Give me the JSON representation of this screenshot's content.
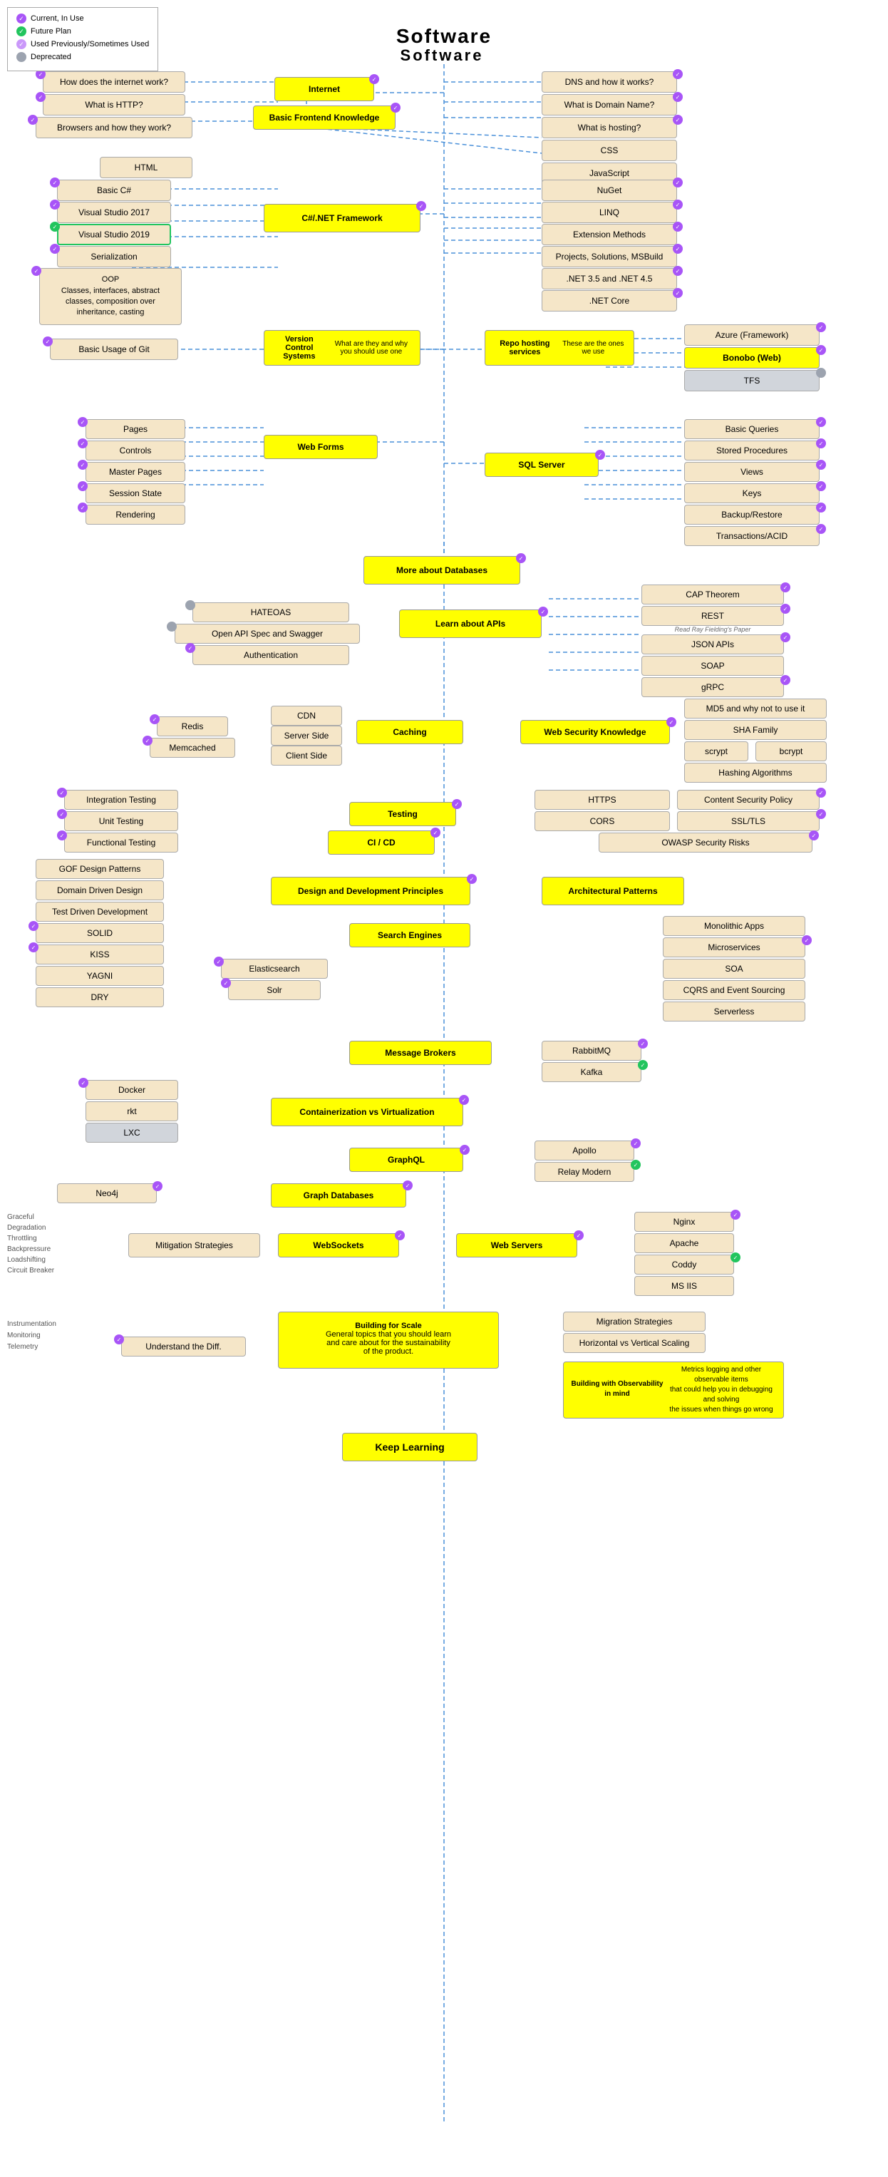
{
  "legend": {
    "items": [
      {
        "label": "Current, In Use",
        "dotClass": "dot-current",
        "icon": "✓"
      },
      {
        "label": "Future Plan",
        "dotClass": "dot-future",
        "icon": "✓"
      },
      {
        "label": "Used Previously/Sometimes Used",
        "dotClass": "dot-used",
        "icon": "✓"
      },
      {
        "label": "Deprecated",
        "dotClass": "dot-deprecated",
        "icon": ""
      }
    ]
  },
  "title": "Software",
  "nodes": {
    "internet": "Internet",
    "basicFrontend": "Basic Frontend Knowledge",
    "howInternet": "How does the internet work?",
    "whatHTTP": "What is HTTP?",
    "browsers": "Browsers and how they work?",
    "dns": "DNS and how it works?",
    "domainName": "What is Domain Name?",
    "hosting": "What is hosting?",
    "css": "CSS",
    "javascript": "JavaScript",
    "html": "HTML",
    "dotnet": "C#/.NET Framework",
    "basicCsharp": "Basic C#",
    "vs2017": "Visual Studio 2017",
    "vs2019": "Visual Studio 2019",
    "serialization": "Serialization",
    "oop": "OOP\nClasses, interfaces, abstract\nclasses, composition over\ninheritance, casting",
    "nuget": "NuGet",
    "linq": "LINQ",
    "extensionMethods": "Extension Methods",
    "projects": "Projects, Solutions, MSBuild",
    "net35": ".NET 3.5 and .NET 4.5",
    "netCore": ".NET Core",
    "vcs": "Version Control Systems\nWhat are they and why you should use one",
    "repoHosting": "Repo hosting services\nThese are the ones we use",
    "basicGit": "Basic Usage of Git",
    "azure": "Azure (Framework)",
    "bonobo": "Bonobo (Web)",
    "tfs": "TFS",
    "webForms": "Web Forms",
    "sqlServer": "SQL Server",
    "pages": "Pages",
    "controls": "Controls",
    "masterPages": "Master Pages",
    "sessionState": "Session State",
    "rendering": "Rendering",
    "basicQueries": "Basic Queries",
    "storedProcs": "Stored Procedures",
    "views": "Views",
    "keys": "Keys",
    "backupRestore": "Backup/Restore",
    "transactions": "Transactions/ACID",
    "moreDatabases": "More about Databases",
    "capTheorem": "CAP Theorem",
    "rest": "REST",
    "readRay": "Read Ray Fielding's Paper",
    "jsonApis": "JSON APIs",
    "soap": "SOAP",
    "grpc": "gRPC",
    "learnAPIs": "Learn about APIs",
    "hateoas": "HATEOAS",
    "openAPI": "Open API Spec and Swagger",
    "authentication": "Authentication",
    "caching": "Caching",
    "cdn": "CDN",
    "serverSide": "Server Side",
    "clientSide": "Client Side",
    "redis": "Redis",
    "memcached": "Memcached",
    "webSecurity": "Web Security Knowledge",
    "md5": "MD5 and why not to use it",
    "shaFamily": "SHA Family",
    "scrypt": "scrypt",
    "bcrypt": "bcrypt",
    "hashingAlgorithms": "Hashing Algorithms",
    "testing": "Testing",
    "integrationTesting": "Integration Testing",
    "unitTesting": "Unit Testing",
    "functionalTesting": "Functional Testing",
    "cicd": "CI / CD",
    "https": "HTTPS",
    "contentSecurity": "Content Security Policy",
    "cors": "CORS",
    "ssltls": "SSL/TLS",
    "owasp": "OWASP Security Risks",
    "designPrinciples": "Design and Development Principles",
    "gof": "GOF Design Patterns",
    "ddd": "Domain Driven Design",
    "tdd": "Test Driven Development",
    "solid": "SOLID",
    "kiss": "KISS",
    "yagni": "YAGNI",
    "dry": "DRY",
    "architecturalPatterns": "Architectural Patterns",
    "monolithicApps": "Monolithic Apps",
    "microservices": "Microservices",
    "soa": "SOA",
    "cqrs": "CQRS and Event Sourcing",
    "serverless": "Serverless",
    "searchEngines": "Search Engines",
    "elasticsearch": "Elasticsearch",
    "solr": "Solr",
    "messageBrokers": "Message Brokers",
    "rabbitMQ": "RabbitMQ",
    "kafka": "Kafka",
    "containerization": "Containerization vs Virtualization",
    "docker": "Docker",
    "rkt": "rkt",
    "lxc": "LXC",
    "graphql": "GraphQL",
    "apollo": "Apollo",
    "relayModern": "Relay Modern",
    "graphDatabases": "Graph Databases",
    "neo4j": "Neo4j",
    "webSockets": "WebSockets",
    "webServers": "Web Servers",
    "nginx": "Nginx",
    "apache": "Apache",
    "coddy": "Coddy",
    "msiis": "MS IIS",
    "mitigationStrategies": "Mitigation Strategies",
    "gracefulDegradation": "Graceful\nDegradation",
    "throttling": "Throttling",
    "backpressure": "Backpressure",
    "loadshifting": "Loadshifting",
    "circuitBreaker": "Circuit Breaker",
    "buildingForScale": "Building for Scale\nGeneral topics that you should learn\nand care about for the sustainability\nof the product.",
    "understandDiff": "Understand the Diff.",
    "instrumentation": "Instrumentation",
    "monitoring": "Monitoring",
    "telemetry": "Telemetry",
    "migrationStrategies": "Migration Strategies",
    "horizontalVertical": "Horizontal vs Vertical Scaling",
    "buildingObservability": "Building with Observability in mind\nMetrics logging and other observable items\nthat could help you in debugging and solving\nthe issues when things go wrong",
    "keepLearning": "Keep Learning"
  }
}
